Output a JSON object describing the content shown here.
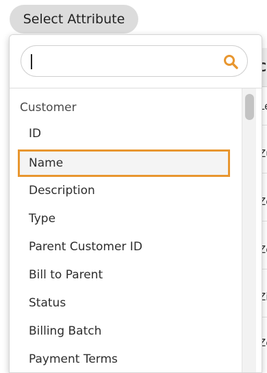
{
  "select_button": {
    "label": "Select Attribute"
  },
  "search": {
    "value": "",
    "placeholder": ""
  },
  "list": {
    "group": "Customer",
    "items": [
      {
        "label": "ID"
      },
      {
        "label": "Name"
      },
      {
        "label": "Description"
      },
      {
        "label": "Type"
      },
      {
        "label": "Parent Customer ID"
      },
      {
        "label": "Bill to Parent"
      },
      {
        "label": "Status"
      },
      {
        "label": "Billing Batch"
      },
      {
        "label": "Payment Terms"
      }
    ]
  },
  "background_table": {
    "header": "Cu",
    "cells": [
      "Le",
      "Zu",
      "Zo",
      "Zo",
      "Zi",
      "Ze",
      "Za"
    ]
  },
  "colors": {
    "accent": "#e8962f",
    "button_bg": "#dcdcdc",
    "selected_bg": "#f4f4f4"
  }
}
